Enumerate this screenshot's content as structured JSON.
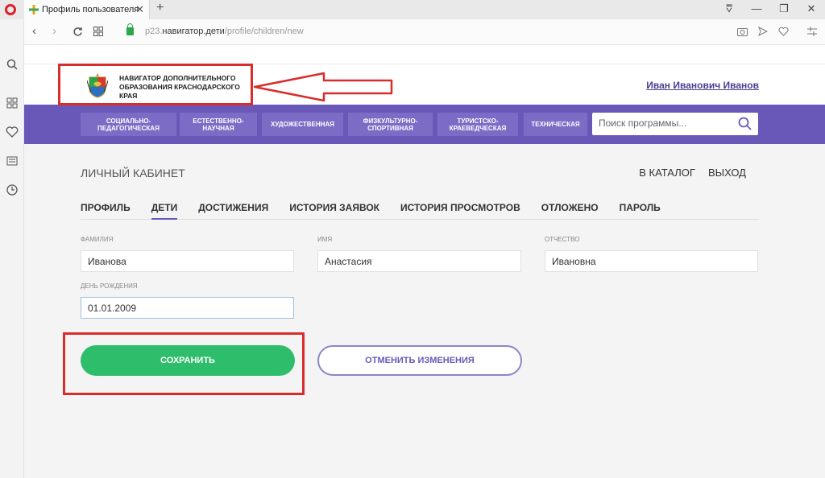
{
  "browser": {
    "tab_title": "Профиль пользователя",
    "tab_close": "✕",
    "new_tab": "+",
    "url_prefix": "p23.",
    "url_host": "навигатор.дети",
    "url_path": "/profile/children/new",
    "window_controls": [
      "⩢",
      "—",
      "❐",
      "✕"
    ]
  },
  "header": {
    "logo_text": "Навигатор дополнительного образования Краснодарского края",
    "user_name": "Иван Иванович Иванов"
  },
  "categories": [
    "Социально-педагогическая",
    "Естественно-научная",
    "Художественная",
    "Физкультурно-спортивная",
    "Туристско-краеведческая",
    "Техническая"
  ],
  "search": {
    "placeholder": "Поиск программы..."
  },
  "cabinet": {
    "title": "ЛИЧНЫЙ КАБИНЕТ",
    "catalog_link": "В КАТАЛОГ",
    "logout_link": "ВЫХОД"
  },
  "profile_tabs": [
    "ПРОФИЛЬ",
    "ДЕТИ",
    "ДОСТИЖЕНИЯ",
    "ИСТОРИЯ ЗАЯВОК",
    "ИСТОРИЯ ПРОСМОТРОВ",
    "ОТЛОЖЕНО",
    "ПАРОЛЬ"
  ],
  "active_tab": "ДЕТИ",
  "form": {
    "surname_label": "Фамилия",
    "surname_value": "Иванова",
    "name_label": "Имя",
    "name_value": "Анастасия",
    "patronymic_label": "Отчество",
    "patronymic_value": "Ивановна",
    "birthday_label": "День рождения",
    "birthday_value": "01.01.2009"
  },
  "buttons": {
    "save": "Сохранить",
    "cancel": "Отменить изменения"
  },
  "colors": {
    "accent": "#6a58b8",
    "save_green": "#2ebd6b",
    "highlight_red": "#d92c2c"
  }
}
